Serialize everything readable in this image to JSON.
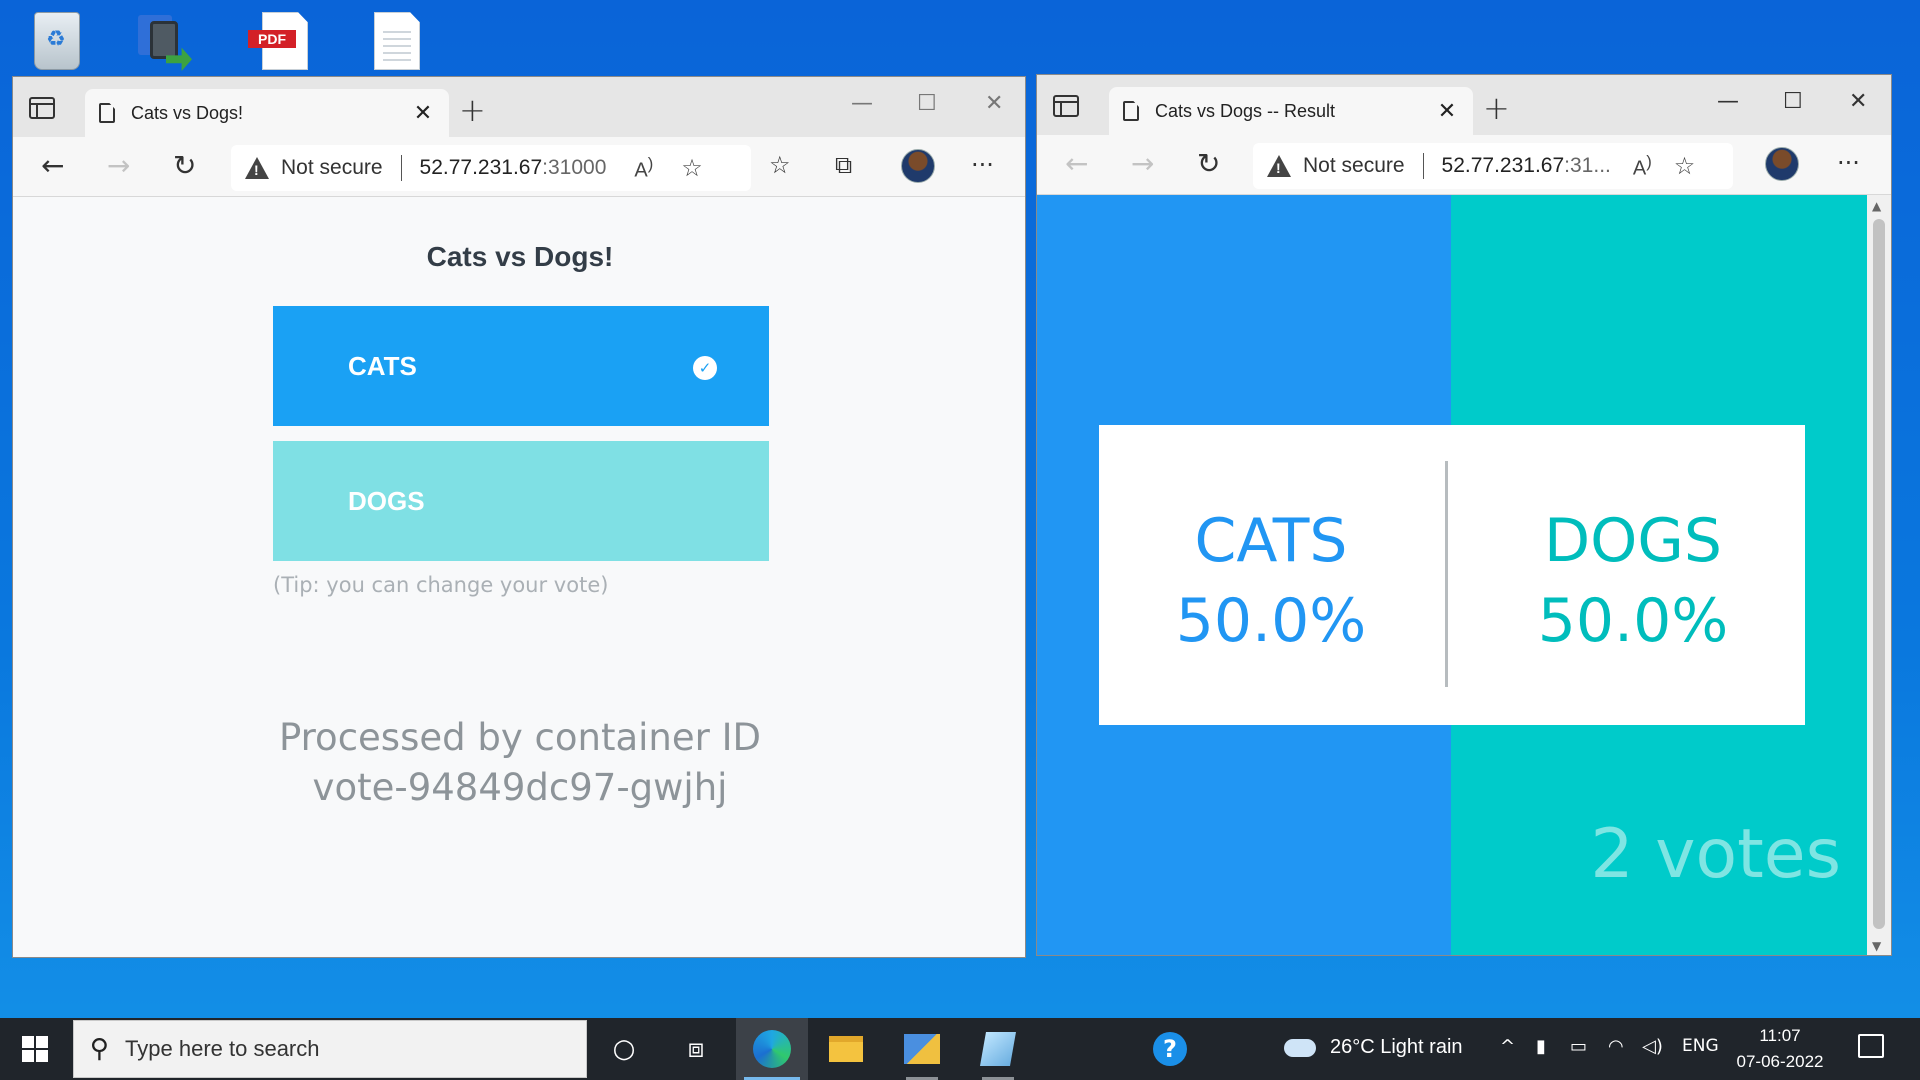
{
  "desktop": {
    "icons": [
      "recycle-bin",
      "vpn-shortcut",
      "pdf-file",
      "text-document"
    ],
    "pdf_label": "PDF"
  },
  "left_window": {
    "tab_title": "Cats vs Dogs!",
    "tab_close": "✕",
    "new_tab": "+",
    "security_label": "Not secure",
    "url_host": "52.77.231.67",
    "url_port": ":31000",
    "page": {
      "title": "Cats vs Dogs!",
      "cats_label": "CATS",
      "dogs_label": "DOGS",
      "selected": "CATS",
      "tip": "(Tip: you can change your vote)",
      "processed_line1": "Processed by container ID",
      "processed_line2": "vote-94849dc97-gwjhj"
    }
  },
  "right_window": {
    "tab_title": "Cats vs Dogs -- Result",
    "tab_close": "✕",
    "new_tab": "+",
    "security_label": "Not secure",
    "url_host": "52.77.231.67",
    "url_port": ":31...",
    "page": {
      "cats_label": "CATS",
      "cats_percent": "50.0%",
      "dogs_label": "DOGS",
      "dogs_percent": "50.0%",
      "votes": "2 votes"
    },
    "colors": {
      "cats": "#2196f3",
      "dogs": "#00cbca"
    }
  },
  "browser_icons": {
    "back": "back-arrow-icon",
    "forward": "forward-arrow-icon",
    "refresh": "refresh-icon",
    "read_aloud": "A⁰",
    "favorites": "favorites-icon",
    "collections": "collections-icon",
    "more": "···"
  },
  "taskbar": {
    "search_placeholder": "Type here to search",
    "weather": "26°C  Light rain",
    "language": "ENG",
    "time": "11:07",
    "date": "07-06-2022"
  }
}
